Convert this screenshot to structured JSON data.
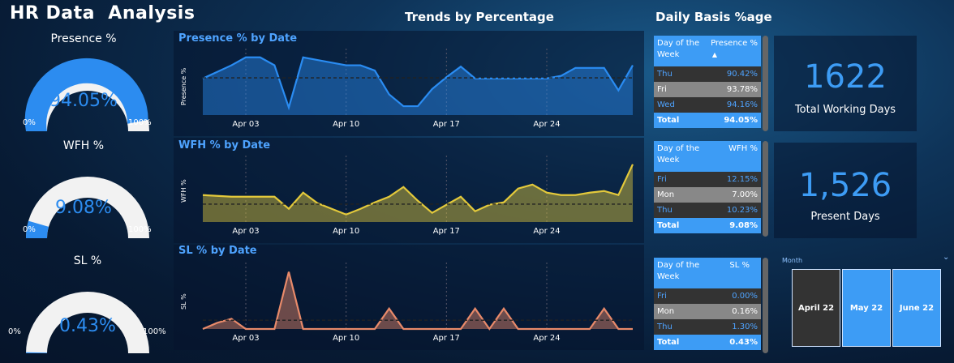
{
  "header": {
    "title": "HR Data  Analysis",
    "trends_title": "Trends by Percentage",
    "daily_title": "Daily Basis %age"
  },
  "gauges": [
    {
      "label": "Presence %",
      "value_text": "94.05%",
      "value": 94.05,
      "min": "0%",
      "max": "100%"
    },
    {
      "label": "WFH %",
      "value_text": "9.08%",
      "value": 9.08,
      "min": "0%",
      "max": "100%"
    },
    {
      "label": "SL %",
      "value_text": "0.43%",
      "value": 0.43,
      "min": "0%",
      "max": "100%"
    }
  ],
  "chart_data": [
    {
      "type": "area",
      "title": "Presence % by Date",
      "ylabel": "Presence %",
      "xlabel": "",
      "x_ticks": [
        "Apr 03",
        "Apr 10",
        "Apr 17",
        "Apr 24"
      ],
      "x": [
        "Mar 31",
        "Apr 01",
        "Apr 02",
        "Apr 03",
        "Apr 04",
        "Apr 05",
        "Apr 06",
        "Apr 07",
        "Apr 08",
        "Apr 09",
        "Apr 10",
        "Apr 11",
        "Apr 12",
        "Apr 13",
        "Apr 14",
        "Apr 15",
        "Apr 16",
        "Apr 17",
        "Apr 18",
        "Apr 19",
        "Apr 20",
        "Apr 21",
        "Apr 22",
        "Apr 23",
        "Apr 24",
        "Apr 25",
        "Apr 26",
        "Apr 27",
        "Apr 28",
        "Apr 29"
      ],
      "values": [
        94.0,
        94.5,
        95.0,
        95.6,
        95.6,
        95.0,
        91.8,
        95.6,
        95.4,
        95.2,
        95.0,
        95.0,
        94.6,
        92.8,
        91.9,
        91.9,
        93.2,
        94.1,
        94.9,
        94.0,
        94.0,
        94.0,
        94.0,
        94.0,
        94.0,
        94.2,
        94.8,
        94.8,
        94.8,
        93.1,
        95.0
      ],
      "average": 94.05,
      "color": "#2a8cf2"
    },
    {
      "type": "area",
      "title": "WFH % by Date",
      "ylabel": "WFH %",
      "xlabel": "",
      "x_ticks": [
        "Apr 03",
        "Apr 10",
        "Apr 17",
        "Apr 24"
      ],
      "values": [
        10.2,
        10.1,
        10.0,
        10.0,
        10.0,
        10.0,
        8.5,
        10.5,
        9.2,
        8.5,
        7.8,
        8.5,
        9.3,
        10.0,
        11.2,
        9.5,
        8.0,
        9.0,
        10.0,
        8.2,
        9.0,
        9.3,
        11.0,
        11.5,
        10.5,
        10.2,
        10.2,
        10.5,
        10.7,
        10.2,
        14.0
      ],
      "average": 9.08,
      "color": "#e3c93b"
    },
    {
      "type": "area",
      "title": "SL % by Date",
      "ylabel": "SL %",
      "xlabel": "",
      "x_ticks": [
        "Apr 03",
        "Apr 10",
        "Apr 17",
        "Apr 24"
      ],
      "values": [
        0,
        0.3,
        0.5,
        0,
        0,
        0,
        2.8,
        0,
        0,
        0,
        0,
        0,
        0,
        1.0,
        0,
        0,
        0,
        0,
        0,
        1.0,
        0,
        1.0,
        0,
        0,
        0,
        0,
        0,
        0,
        1.0,
        0,
        0
      ],
      "average": 0.43,
      "color": "#e88a6a"
    }
  ],
  "tables": [
    {
      "col1": "Day of the Week",
      "col2": "Presence %",
      "sort_indicator": "▲",
      "rows": [
        {
          "day": "Thu",
          "val": "90.42%"
        },
        {
          "day": "Fri",
          "val": "93.78%"
        },
        {
          "day": "Wed",
          "val": "94.16%"
        }
      ],
      "total_label": "Total",
      "total_val": "94.05%"
    },
    {
      "col1": "Day of the Week",
      "col2": "WFH %",
      "rows": [
        {
          "day": "Fri",
          "val": "12.15%"
        },
        {
          "day": "Mon",
          "val": "7.00%"
        },
        {
          "day": "Thu",
          "val": "10.23%"
        }
      ],
      "total_label": "Total",
      "total_val": "9.08%"
    },
    {
      "col1": "Day of the Week",
      "col2": "SL %",
      "rows": [
        {
          "day": "Fri",
          "val": "0.00%"
        },
        {
          "day": "Mon",
          "val": "0.16%"
        },
        {
          "day": "Thu",
          "val": "1.30%"
        }
      ],
      "total_label": "Total",
      "total_val": "0.43%"
    }
  ],
  "kpis": [
    {
      "value": "1622",
      "label": "Total Working Days"
    },
    {
      "value": "1,526",
      "label": "Present Days"
    }
  ],
  "slicer": {
    "label": "Month",
    "chevron": "⌄",
    "items": [
      "April 22",
      "May 22",
      "June 22"
    ],
    "selected": "April 22"
  },
  "colors": {
    "accent": "#3d9cf5",
    "gauge_track": "#f2f2f2"
  }
}
